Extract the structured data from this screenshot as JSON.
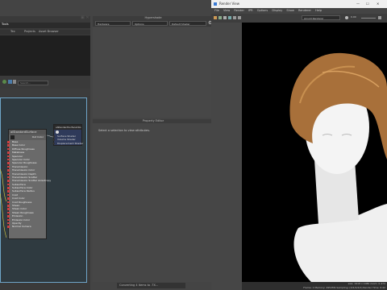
{
  "left": {
    "tabs": [
      "Tools"
    ],
    "subtabs": [
      "Tex",
      "Projects",
      "Asset Browser"
    ],
    "search_placeholder": "Search...",
    "shader_node": {
      "title": "aiStandardSurface",
      "out_label": "Out Color",
      "ports": [
        "Base",
        "Base Color",
        "Diffuse Roughness",
        "Metalness",
        "Specular",
        "Specular Color",
        "Specular Roughness",
        "Transmission",
        "Transmission Color",
        "Transmission Depth",
        "Transmission Scatter",
        "Transmission Scatter Anisotropy",
        "Subsurface",
        "Subsurface Color",
        "Subsurface Radius",
        "Coat",
        "Coat Color",
        "Coat Roughness",
        "Sheen",
        "Sheen Color",
        "Sheen Roughness",
        "Emission",
        "Emission Color",
        "Opacity",
        "Normal Camera"
      ]
    },
    "shading_group": {
      "title": "aiStandardSurface1SG",
      "rows": [
        "Surface Shader",
        "Volume Shader",
        "Displacement Shader"
      ]
    }
  },
  "hypershade": {
    "title": "Hypershade",
    "dropdowns": [
      "Hardware",
      "Options",
      "Default Shader"
    ]
  },
  "property_editor": {
    "title": "Property Editor",
    "message": "Select a selection to view attributes."
  },
  "status": {
    "progress_text": "Converting 4 Items to .TX..."
  },
  "render_view": {
    "title": "Render View",
    "menu": [
      "File",
      "View",
      "Render",
      "IPR",
      "Options",
      "Display",
      "Show",
      "Renderer",
      "Help"
    ],
    "render_selector": "Arnold Renderer",
    "exposure_value": "0.00",
    "status_line1": "size: 1918 x 1080  zoom: 0.474",
    "status_line2": "Frame: 1  Memory: 4952Mb  Sampling: [3/2/2/2/2]  Render Time: 0:42"
  }
}
